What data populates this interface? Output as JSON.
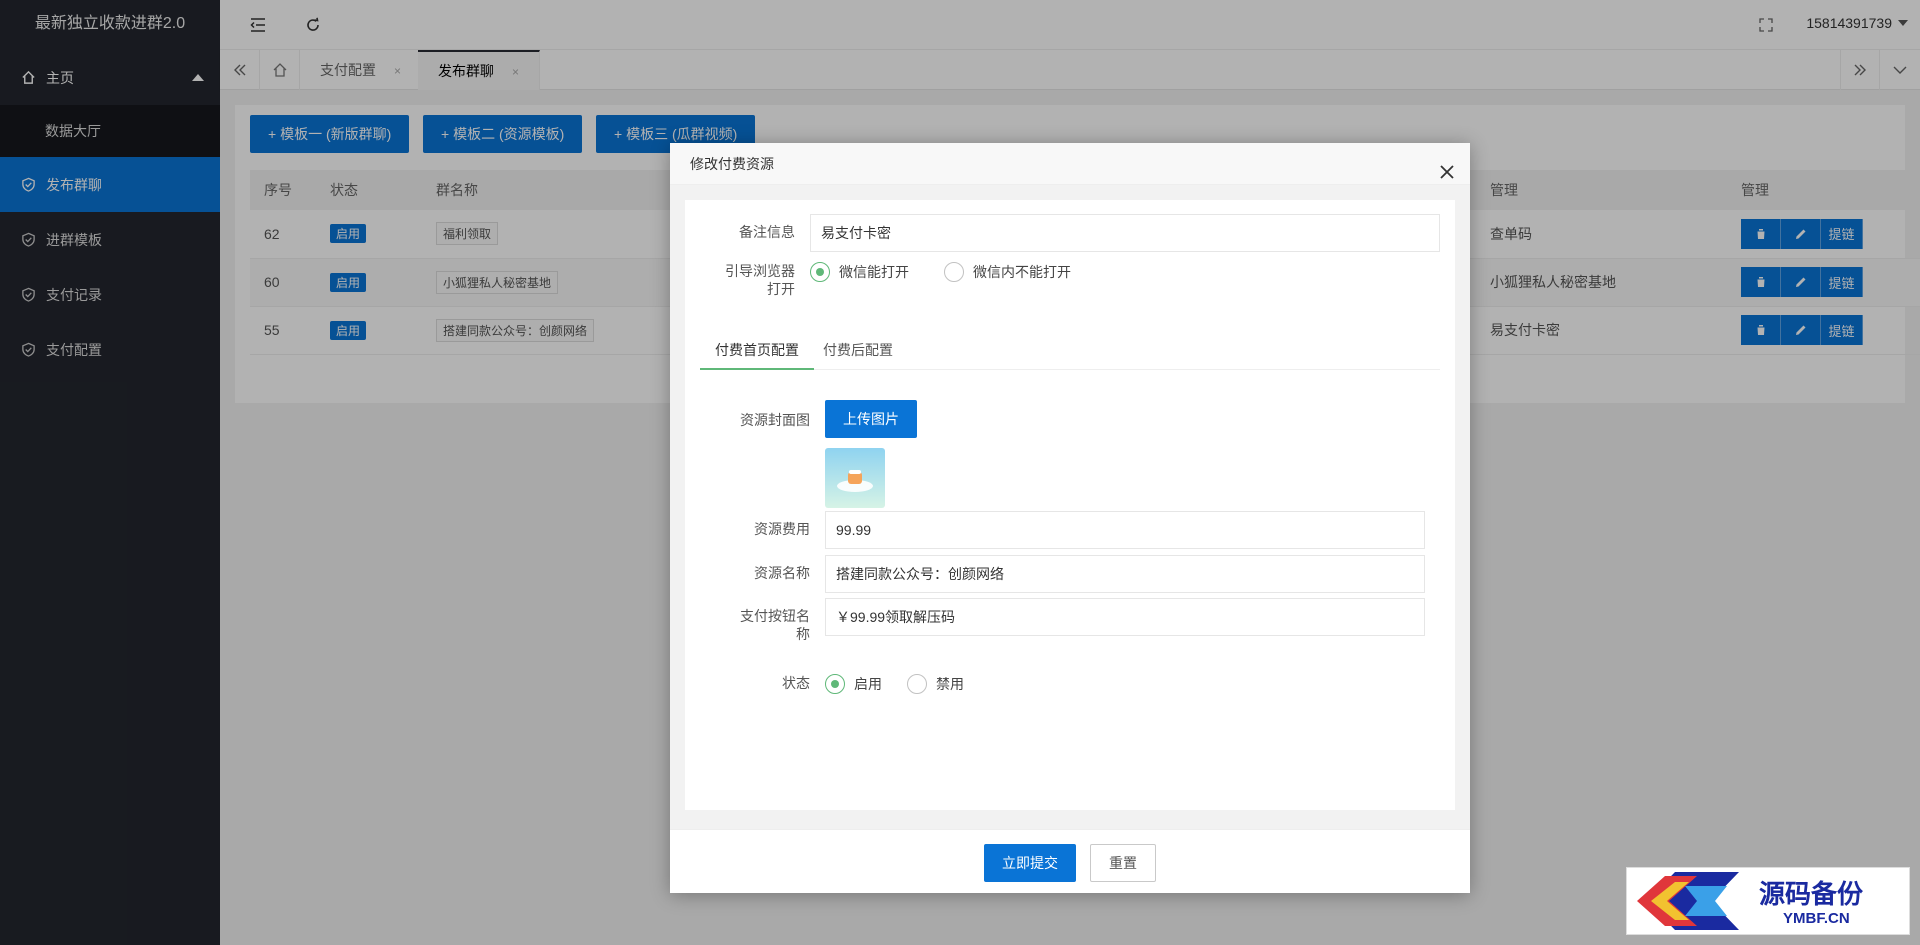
{
  "app": {
    "title": "最新独立收款进群2.0"
  },
  "sidebar": {
    "items": [
      {
        "label": "主页",
        "icon": "home-icon"
      },
      {
        "label": "数据大厅"
      },
      {
        "label": "发布群聊",
        "icon": "shield-check-icon",
        "active": true
      },
      {
        "label": "进群模板",
        "icon": "shield-check-icon"
      },
      {
        "label": "支付记录",
        "icon": "shield-check-icon"
      },
      {
        "label": "支付配置",
        "icon": "shield-check-icon"
      }
    ]
  },
  "header": {
    "user": "15814391739"
  },
  "tabs": [
    {
      "label": "支付配置",
      "close": "×"
    },
    {
      "label": "发布群聊",
      "close": "×",
      "active": true
    }
  ],
  "toolbar": {
    "tpl1": "+ 模板一 (新版群聊)",
    "tpl2": "+ 模板二 (资源模板)",
    "tpl3": "+ 模板三 (瓜群视频)"
  },
  "table": {
    "headers": [
      "序号",
      "状态",
      "群名称",
      "管理",
      "管理"
    ],
    "rows": [
      {
        "id": "62",
        "status": "启用",
        "name": "福利领取",
        "manage": "查单码"
      },
      {
        "id": "60",
        "status": "启用",
        "name": "小狐狸私人秘密基地",
        "manage": "小狐狸私人秘密基地"
      },
      {
        "id": "55",
        "status": "启用",
        "name": "搭建同款公众号：创颜网络",
        "manage": "易支付卡密"
      }
    ],
    "op_link": "提链"
  },
  "modal": {
    "title": "修改付费资源",
    "remark_label": "备注信息",
    "remark_value": "易支付卡密",
    "browser_label_1": "引导浏览器",
    "browser_label_2": "打开",
    "browser_opt1": "微信能打开",
    "browser_opt2": "微信内不能打开",
    "subtab1": "付费首页配置",
    "subtab2": "付费后配置",
    "cover_label": "资源封面图",
    "upload": "上传图片",
    "fee_label": "资源费用",
    "fee_value": "99.99",
    "name_label": "资源名称",
    "name_value": "搭建同款公众号：创颜网络",
    "paybtn_label_1": "支付按钮名",
    "paybtn_label_2": "称",
    "paybtn_value": "￥99.99领取解压码",
    "status_label": "状态",
    "status_opt1": "启用",
    "status_opt2": "禁用",
    "submit": "立即提交",
    "reset": "重置"
  },
  "watermark": {
    "cn": "源码备份",
    "en": "YMBF.CN"
  },
  "colors": {
    "primary": "#0a74d6",
    "sidebar": "#23262e",
    "radio": "#5fb878"
  }
}
